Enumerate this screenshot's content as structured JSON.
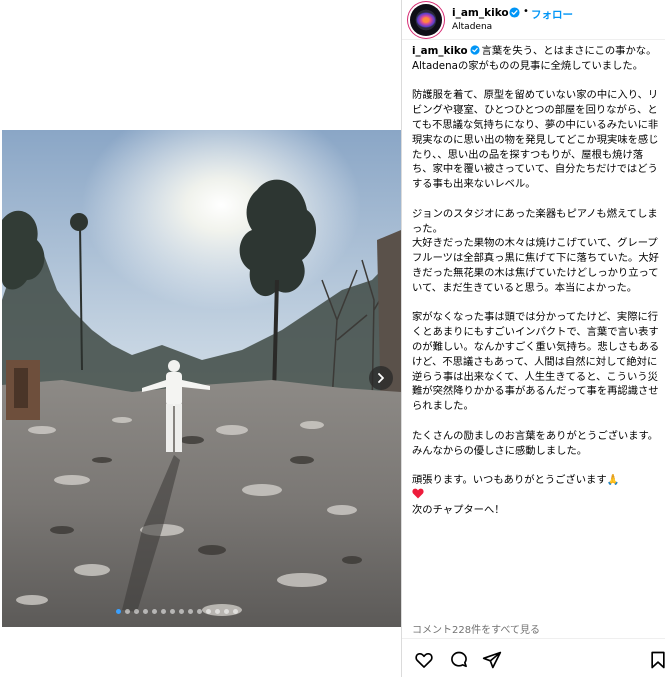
{
  "post": {
    "username": "i_am_kiko",
    "separator": "•",
    "follow_label": "フォロー",
    "location": "Altadena"
  },
  "caption": {
    "username": "i_am_kiko",
    "p1": "言葉を失う、とはまさにこの事かな。\nAltadenaの家がものの見事に全焼していました。",
    "p2": "防護服を着て、原型を留めていない家の中に入り、リビングや寝室、ひとつひとつの部屋を回りながら、とても不思議な気持ちになり、夢の中にいるみたいに非現実なのに思い出の物を発見してどこか現実味を感じたり、、思い出の品を探すつもりが、屋根も焼け落ち、家中を覆い被さっていて、自分たちだけではどうする事も出来ないレベル。",
    "p3": "ジョンのスタジオにあった楽器もピアノも燃えてしまった。\n大好きだった果物の木々は焼けこげていて、グレープフルーツは全部真っ黒に焦げて下に落ちていた。大好きだった無花果の木は焦げていたけどしっかり立っていて、まだ生きていると思う。本当によかった。",
    "p4": "家がなくなった事は頭では分かってたけど、実際に行くとあまりにもすごいインパクトで、言葉で言い表すのが難しい。なんかすごく重い気持ち。悲しさもあるけど、不思議さもあって、人間は自然に対して絶対に逆らう事は出来なくて、人生生きてると、こういう災難が突然降りかかる事があるんだって事を再認識させられました。",
    "p5": "たくさんの励ましのお言葉をありがとうございます。\nみんなからの優しさに感動しました。",
    "p6_line1": "頑張ります。いつもありがとうございます🙏",
    "p6_line3": "次のチャプターへ！"
  },
  "comments": {
    "view_all": "コメント228件をすべて見る"
  },
  "carousel": {
    "slide_count": 14,
    "active_index": 0
  },
  "colors": {
    "accent": "#0095f6",
    "muted": "#737373",
    "heart": "#ed1c3b"
  },
  "icons": {
    "like": "heart-outline-icon",
    "comment": "comment-bubble-icon",
    "share": "paper-plane-icon",
    "save": "bookmark-icon",
    "next": "chevron-right-icon",
    "verified": "verified-badge-icon"
  }
}
